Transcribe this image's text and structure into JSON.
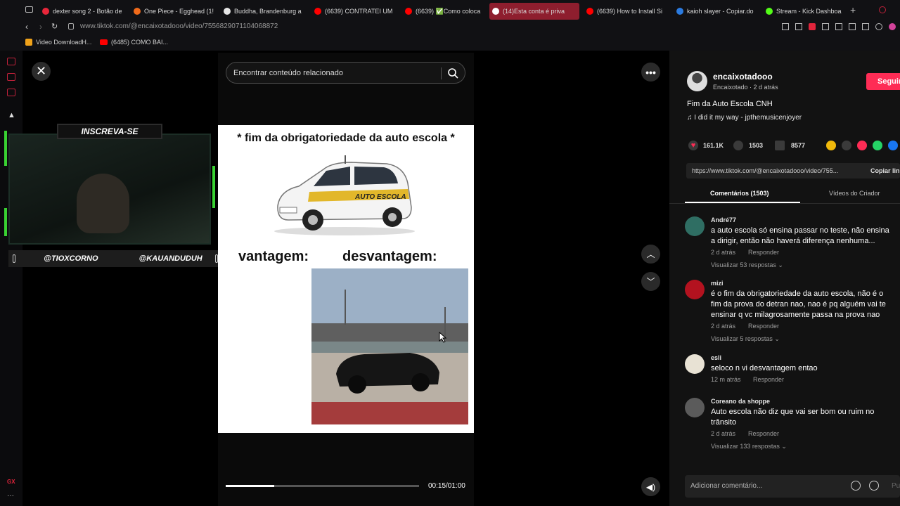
{
  "browser": {
    "tabs": [
      {
        "label": "dexter song 2 - Botão de",
        "color": "#e8263a",
        "active": false
      },
      {
        "label": "One Piece - Egghead (1!",
        "color": "#f06a1a",
        "active": false
      },
      {
        "label": "Buddha, Brandenburg a",
        "color": "#e6e6e6",
        "active": false
      },
      {
        "label": "(6639) CONTRATEI UM",
        "color": "#ff0000",
        "active": false
      },
      {
        "label": "(6639) ✅Como coloca",
        "color": "#ff0000",
        "active": false
      },
      {
        "label": "(14)Esta conta é priva",
        "color": "#ffffff",
        "active": true
      },
      {
        "label": "(6639) How to Install Si",
        "color": "#ff0000",
        "active": false
      },
      {
        "label": "kaioh slayer - Copiar.do",
        "color": "#2b7be0",
        "active": false
      },
      {
        "label": "Stream - Kick Dashboa",
        "color": "#53fc18",
        "active": false
      }
    ],
    "url": "www.tiktok.com/@encaixotadooo/video/7556829071104068872",
    "bookmarks": [
      "Video DownloadH...",
      "(6485) COMO BAI..."
    ]
  },
  "video": {
    "search_placeholder": "Encontrar conteúdo relacionado",
    "meme_title": "* fim da obrigatoriedade da auto escola *",
    "car_text": "AUTO ESCOLA",
    "label_left": "vantagem:",
    "label_right": "desvantagem:",
    "time": "00:15/01:00",
    "progress": 0.25
  },
  "overlay": {
    "title": "INSCREVA-SE",
    "handle_left": "@TIOXCORNO",
    "handle_right": "@KAUANDUDUH"
  },
  "post": {
    "username": "encaixotadooo",
    "display_name": "Encaixotado",
    "age": "2 d atrás",
    "follow_label": "Seguir",
    "description": "Fim da Auto Escola CNH",
    "music": "I did it my way - jpthemusicenjoyer",
    "likes": "161.1K",
    "comments": "1503",
    "saves": "8577",
    "link": "https://www.tiktok.com/@encaixotadooo/video/755...",
    "copy_label": "Copiar link",
    "tab_comments": "Comentários (1503)",
    "tab_creator": "Vídeos do Criador",
    "comment_placeholder": "Adicionar comentário...",
    "post_label": "Publicar"
  },
  "comments": [
    {
      "name": "André77",
      "text": "a auto escola só ensina passar no teste, não ensina a dirigir, então não haverá diferença nenhuma...",
      "time": "2 d atrás",
      "reply": "Responder",
      "more": "Visualizar 53 respostas",
      "avatar": "#2f6e63"
    },
    {
      "name": "mizi",
      "text": "é o fim da obrigatoriedade da auto escola, não é o fim da prova do detran nao, nao é pq alguém vai te ensinar q vc milagrosamente passa na prova nao",
      "time": "2 d atrás",
      "reply": "Responder",
      "more": "Visualizar 5 respostas",
      "avatar": "#b3121f"
    },
    {
      "name": "esli",
      "text": "seloco n vi desvantagem entao",
      "time": "12 m atrás",
      "reply": "Responder",
      "more": "",
      "avatar": "#e8e2d4"
    },
    {
      "name": "Coreano da shoppe",
      "text": "Auto escola não diz que vai ser bom ou ruim no trânsito",
      "time": "2 d atrás",
      "reply": "Responder",
      "more": "Visualizar 133 respostas",
      "avatar": "#5b5b5b"
    }
  ]
}
